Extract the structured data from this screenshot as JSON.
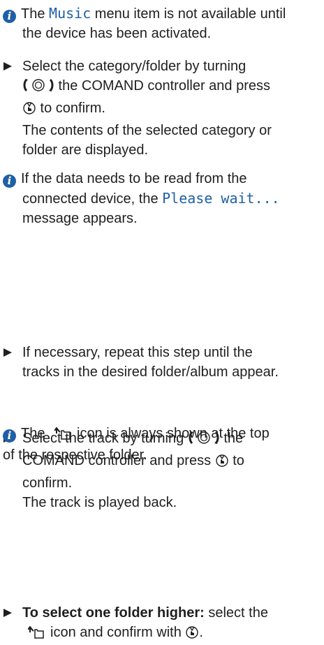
{
  "notes": {
    "music_note": {
      "pre": "The ",
      "display": "Music",
      "post_line1": " menu item is not available until",
      "line2": "the device has been activated."
    },
    "read_note": {
      "line1": "If the data needs to be read from the",
      "line2_pre": "connected device, the ",
      "display": "Please wait...",
      "line3": "message appears."
    },
    "folder_icon_note": {
      "pre": "The ",
      "post": "icon is always shown at the top",
      "line2": "of the respective folder."
    }
  },
  "steps": {
    "select_category": {
      "line1": "Select the category/folder by turning",
      "line2_post": " the COMAND controller and press",
      "line3_post": " to confirm.",
      "result1": "The contents of the selected category or",
      "result2": "folder are displayed."
    },
    "repeat": {
      "line1": "If necessary, repeat this step until the",
      "line2": "tracks in the desired folder/album appear."
    },
    "select_track": {
      "line1_pre": "Select the track by turning ",
      "line1_post": " the",
      "line2_pre": "COMAND controller and press ",
      "line2_post": " to",
      "line3": "confirm.",
      "result": "The track is played back."
    },
    "folder_up": {
      "bold": "To select one folder higher:",
      "line1_post": " select the",
      "line2_post": "icon and confirm with ",
      "line2_end": "."
    }
  },
  "icons": {
    "info": "info-circle-icon",
    "bullet": "triangle-bullet-icon",
    "controller_turn": "controller-turn-icon",
    "controller_press": "controller-press-icon",
    "folder_up": "folder-up-icon"
  },
  "colors": {
    "info_blue": "#1f5fa6",
    "display_text": "#1f5fa6",
    "body_text": "#1f1f1f"
  }
}
